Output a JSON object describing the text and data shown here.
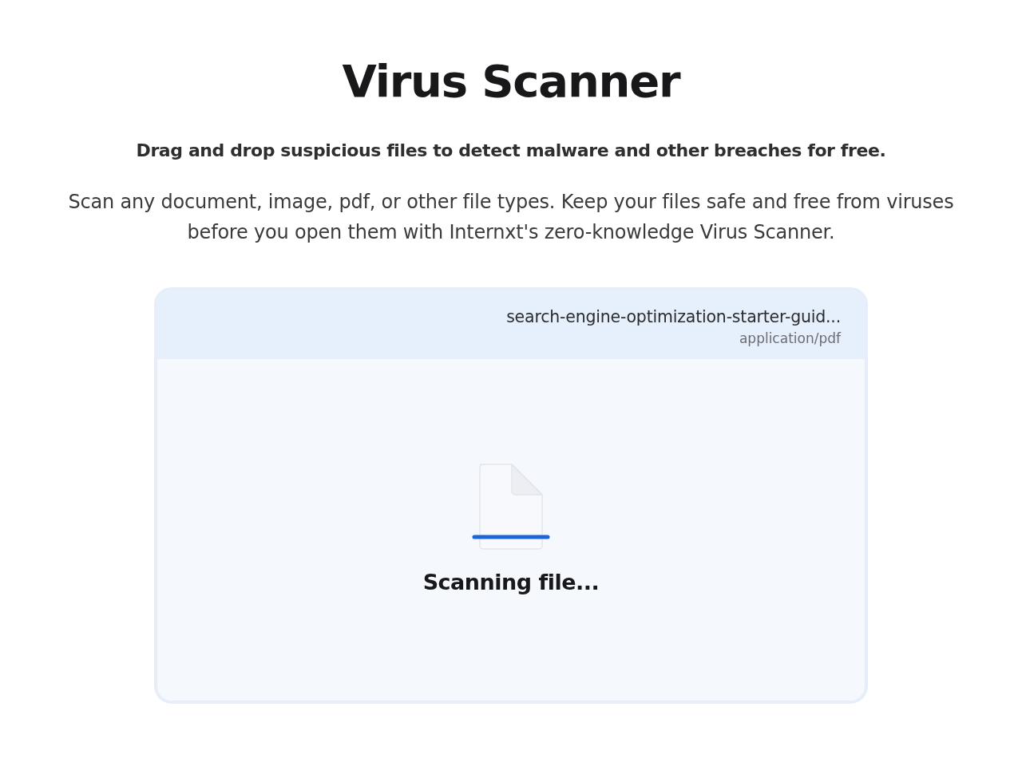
{
  "title": "Virus Scanner",
  "subtitle": "Drag and drop suspicious files to detect malware and other breaches for free.",
  "description": "Scan any document, image, pdf, or other file types. Keep your files safe and free from viruses before you open them with Internxt's zero-knowledge Virus Scanner.",
  "scanner": {
    "file": {
      "name": "search-engine-optimization-starter-guid...",
      "type": "application/pdf"
    },
    "status": "Scanning file..."
  }
}
